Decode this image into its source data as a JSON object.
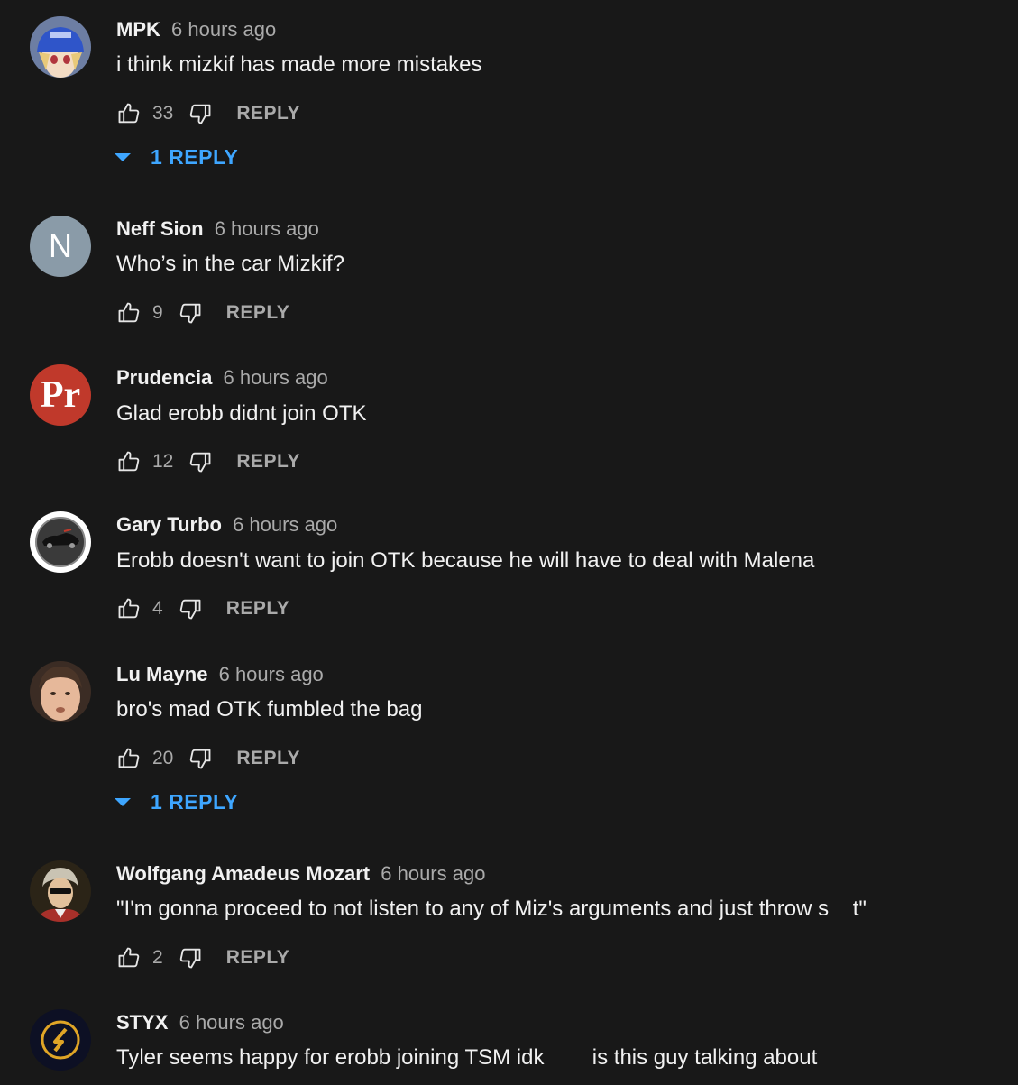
{
  "colors": {
    "background": "#181818",
    "text_primary": "#f1f1f1",
    "text_secondary": "#aaaaaa",
    "link_blue": "#3ea6ff"
  },
  "comments": [
    {
      "author": "MPK",
      "time": "6 hours ago",
      "text": "i think mizkif has made more mistakes",
      "likes": "33",
      "reply_label": "REPLY",
      "replies_label": "1 REPLY",
      "avatar": "anime-girl-avatar"
    },
    {
      "author": "Neff Sion",
      "time": "6 hours ago",
      "text": "Who’s in the car Mizkif?",
      "likes": "9",
      "reply_label": "REPLY",
      "avatar_letter": "N"
    },
    {
      "author": "Prudencia",
      "time": "6 hours ago",
      "text": "Glad erobb didnt join OTK",
      "likes": "12",
      "reply_label": "REPLY",
      "avatar_letter": "Pr"
    },
    {
      "author": "Gary Turbo",
      "time": "6 hours ago",
      "text": "Erobb doesn't want to join OTK because he will have to deal with Malena",
      "likes": "4",
      "reply_label": "REPLY",
      "avatar": "car-logo-avatar"
    },
    {
      "author": "Lu Mayne",
      "time": "6 hours ago",
      "text": "bro's mad OTK fumbled the bag",
      "likes": "20",
      "reply_label": "REPLY",
      "replies_label": "1 REPLY",
      "avatar": "face-photo-avatar"
    },
    {
      "author": "Wolfgang Amadeus Mozart",
      "time": "6 hours ago",
      "text": "\"I'm gonna proceed to not listen to any of Miz's arguments and just throw s    t\"",
      "likes": "2",
      "reply_label": "REPLY",
      "avatar": "mozart-portrait-avatar"
    },
    {
      "author": "STYX",
      "time": "6 hours ago",
      "text": "Tyler seems happy for erobb joining TSM idk        is this guy talking about",
      "avatar": "styx-logo-avatar"
    }
  ]
}
